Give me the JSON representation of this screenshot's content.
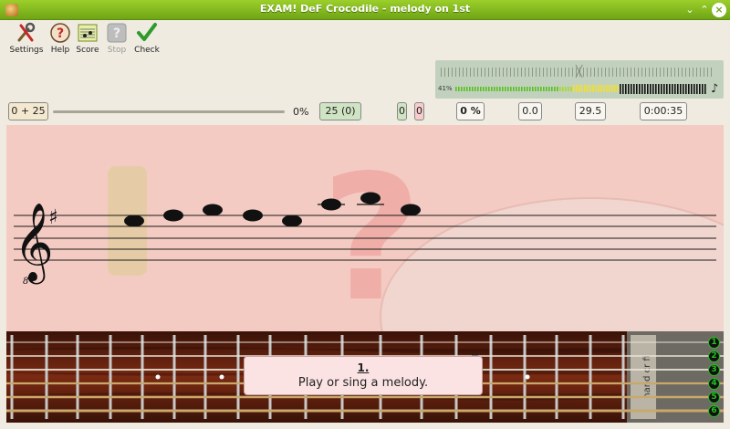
{
  "window": {
    "title": "EXAM! DeF Crocodile - melody on 1st"
  },
  "toolbar": {
    "items": [
      {
        "label": "Settings",
        "icon": "settings-icon"
      },
      {
        "label": "Help",
        "icon": "help-icon"
      },
      {
        "label": "Score",
        "icon": "score-icon"
      },
      {
        "label": "Stop",
        "icon": "stop-icon",
        "disabled": true
      },
      {
        "label": "Check",
        "icon": "check-icon"
      }
    ]
  },
  "meter": {
    "volume_pct": "41%",
    "level": 0.41
  },
  "progress": {
    "answered": "0 + 25",
    "percent": "0%",
    "total": "25 (0)",
    "correct": "0",
    "wrong": "0",
    "effectiveness": "0 %",
    "average_time": "0.0",
    "question_time": "29.5",
    "total_time": "0:00:35"
  },
  "hint": {
    "number": "1.",
    "text": "Play or sing a melody."
  },
  "strings": [
    "1",
    "2",
    "3",
    "4",
    "5",
    "6"
  ],
  "colors": {
    "titlebar": "#8abd1e",
    "score_bg": "#f4cbc3",
    "string_number": "#25c020"
  }
}
